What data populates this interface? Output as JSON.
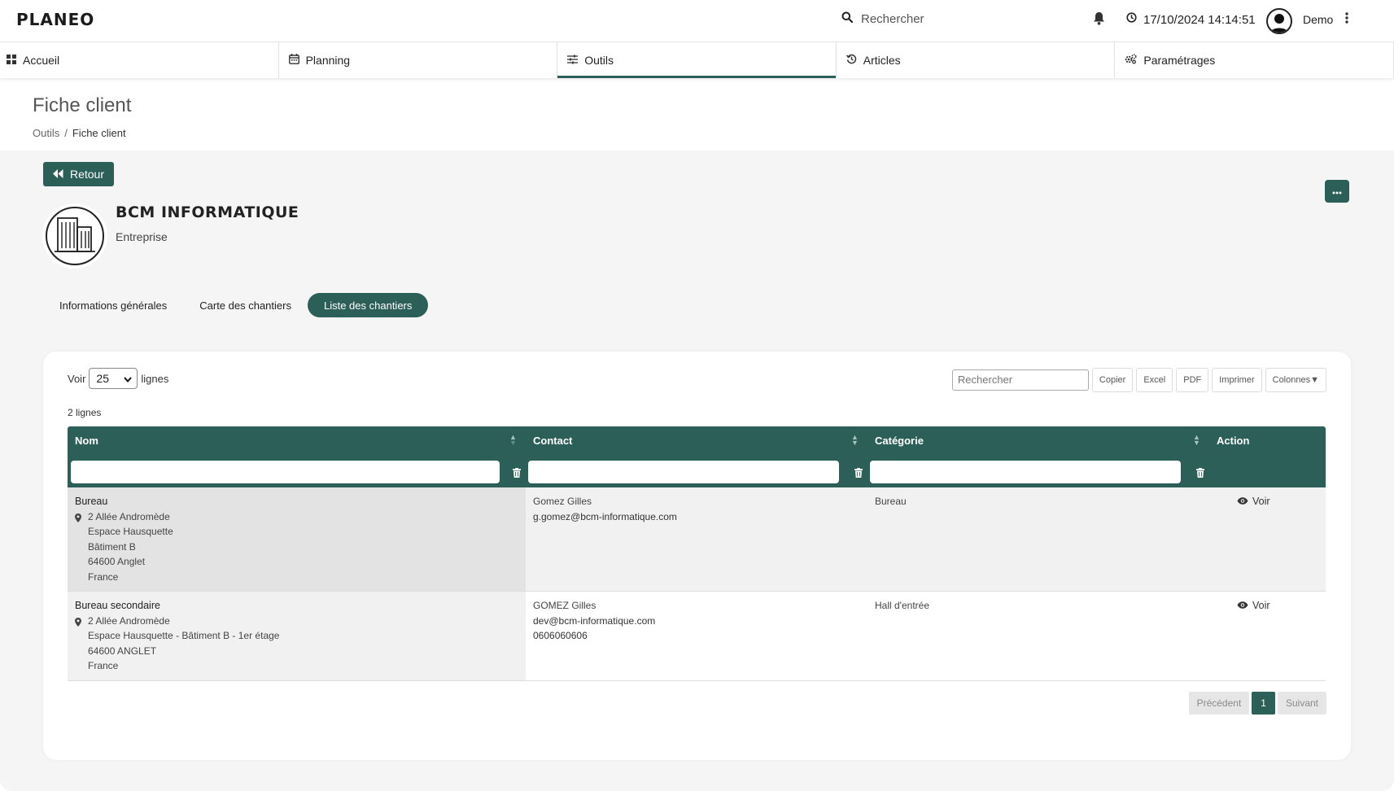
{
  "app": {
    "logo": "PLANEO"
  },
  "topbar": {
    "search_label": "Rechercher",
    "datetime": "17/10/2024 14:14:51",
    "user_name": "Demo"
  },
  "nav": {
    "items": [
      {
        "label": "Accueil",
        "icon": "grid-icon"
      },
      {
        "label": "Planning",
        "icon": "calendar-icon"
      },
      {
        "label": "Outils",
        "icon": "sliders-icon",
        "active": true
      },
      {
        "label": "Articles",
        "icon": "history-icon"
      },
      {
        "label": "Paramétrages",
        "icon": "cogs-icon"
      }
    ]
  },
  "header": {
    "title": "Fiche client",
    "breadcrumb": [
      "Outils",
      "/",
      "Fiche client"
    ]
  },
  "actions": {
    "back_label": "Retour"
  },
  "client": {
    "name": "BCM INFORMATIQUE",
    "type": "Entreprise"
  },
  "tabs": [
    {
      "label": "Informations générales"
    },
    {
      "label": "Carte des chantiers"
    },
    {
      "label": "Liste des chantiers",
      "active": true
    }
  ],
  "table_controls": {
    "show_label": "Voir",
    "page_size": "25",
    "lines_label": "lignes",
    "count_text": "2 lignes",
    "search_placeholder": "Rechercher",
    "buttons": [
      "Copier",
      "Excel",
      "PDF",
      "Imprimer",
      "Colonnes▼"
    ]
  },
  "table": {
    "columns": [
      "Nom",
      "Contact",
      "Catégorie",
      "Action"
    ],
    "rows": [
      {
        "nom": "Bureau",
        "address": [
          "2 Allée Andromède",
          "Espace Hausquette",
          "Bâtiment B",
          "64600 Anglet",
          "France"
        ],
        "contact": [
          "Gomez Gilles",
          "g.gomez@bcm-informatique.com"
        ],
        "categorie": "Bureau",
        "action": "Voir"
      },
      {
        "nom": "Bureau secondaire",
        "address": [
          "2 Allée Andromède",
          "Espace Hausquette - Bâtiment B - 1er étage",
          "64600 ANGLET",
          "France"
        ],
        "contact": [
          "GOMEZ Gilles",
          "dev@bcm-informatique.com",
          "0606060606"
        ],
        "categorie": "Hall d'entrée",
        "action": "Voir"
      }
    ]
  },
  "pagination": {
    "prev": "Précédent",
    "current": "1",
    "next": "Suivant"
  },
  "colors": {
    "accent": "#2c5f58",
    "background": "#f5f5f5"
  }
}
